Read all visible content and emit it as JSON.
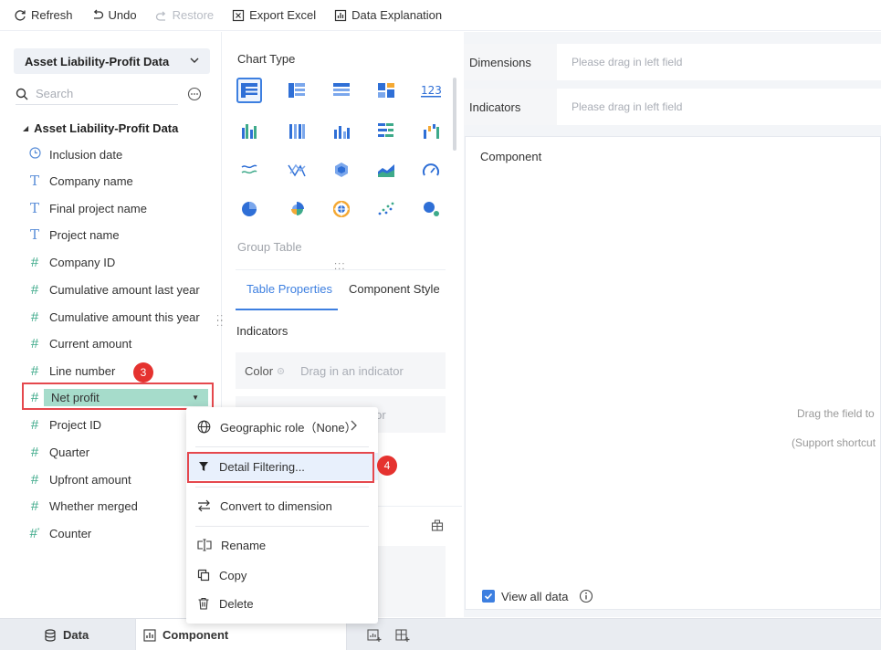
{
  "toolbar": {
    "refresh": "Refresh",
    "undo": "Undo",
    "restore": "Restore",
    "export_excel": "Export Excel",
    "data_explanation": "Data Explanation"
  },
  "left_panel": {
    "dataset_name": "Asset Liability-Profit Data",
    "search_placeholder": "Search",
    "tree_root": "Asset Liability-Profit Data",
    "fields": [
      {
        "label": "Inclusion date",
        "type": "date-icon"
      },
      {
        "label": "Company name",
        "type": "text-icon"
      },
      {
        "label": "Final project name",
        "type": "text-icon"
      },
      {
        "label": "Project name",
        "type": "text-icon"
      },
      {
        "label": "Company ID",
        "type": "number-icon"
      },
      {
        "label": "Cumulative amount last year",
        "type": "number-icon"
      },
      {
        "label": "Cumulative amount this year",
        "type": "number-icon"
      },
      {
        "label": "Current amount",
        "type": "number-icon"
      },
      {
        "label": "Line number",
        "type": "number-icon"
      },
      {
        "label": "Net profit",
        "type": "number-icon"
      },
      {
        "label": "Project ID",
        "type": "number-icon"
      },
      {
        "label": "Quarter",
        "type": "number-icon"
      },
      {
        "label": "Upfront amount",
        "type": "number-icon"
      },
      {
        "label": "Whether merged",
        "type": "number-icon"
      },
      {
        "label": "Counter",
        "type": "counter-icon"
      }
    ],
    "step_badge_1": "3"
  },
  "middle_panel": {
    "chart_type_title": "Chart Type",
    "group_table": "Group Table",
    "tabs": [
      "Table Properties",
      "Component Style"
    ],
    "indicators_title": "Indicators",
    "color_label": "Color",
    "color_placeholder": "Drag in an indicator",
    "second_placeholder": "licator"
  },
  "right_panel": {
    "dimensions_label": "Dimensions",
    "dimensions_placeholder": "Please drag in left field",
    "indicators_label": "Indicators",
    "indicators_placeholder": "Please drag in left field",
    "component_title": "Component",
    "drag_hint": "Drag the field to",
    "shortcut_hint": "(Support shortcut",
    "view_all": "View all data"
  },
  "context_menu": {
    "geographic_role": "Geographic role（None）",
    "detail_filtering": "Detail Filtering...",
    "convert_to_dimension": "Convert to dimension",
    "rename": "Rename",
    "copy": "Copy",
    "delete": "Delete",
    "step_badge_2": "4"
  },
  "bottom_bar": {
    "data_tab": "Data",
    "component_tab": "Component"
  },
  "colors": {
    "accent": "#3d7fe0",
    "selected_field": "#a6dccb",
    "highlight_box": "#e5484d",
    "badge": "#e5322f"
  }
}
